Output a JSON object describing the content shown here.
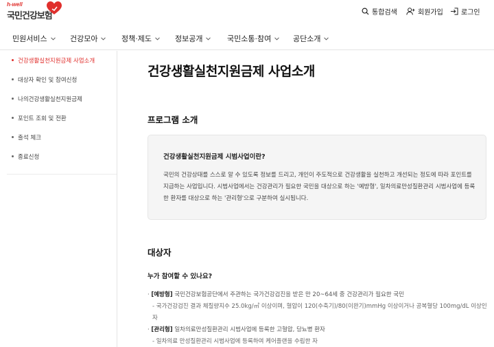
{
  "header": {
    "logo_hwell": "h-well",
    "logo_text": "국민건강보험",
    "utils": [
      {
        "label": "통합검색",
        "icon": "search-icon"
      },
      {
        "label": "회원가입",
        "icon": "user-plus-icon"
      },
      {
        "label": "로그인",
        "icon": "login-icon"
      }
    ]
  },
  "gnb": {
    "items": [
      {
        "label": "민원서비스"
      },
      {
        "label": "건강모아"
      },
      {
        "label": "정책·제도"
      },
      {
        "label": "정보공개"
      },
      {
        "label": "국민소통·참여"
      },
      {
        "label": "공단소개"
      }
    ]
  },
  "lnb": {
    "items": [
      {
        "label": "건강생활실천지원금제 사업소개",
        "active": true
      },
      {
        "label": "대상자 확인 및 참여신청"
      },
      {
        "label": "나의건강생활실천지원금제"
      },
      {
        "label": "포인트 조회 및 전환"
      },
      {
        "label": "출석 체크"
      },
      {
        "label": "종료신청"
      }
    ]
  },
  "main": {
    "title": "건강생활실천지원금제 사업소개",
    "program_section_title": "프로그램 소개",
    "infobox": {
      "title": "건강생활실천지원금제 시범사업이란?",
      "body": "국민의 건강상태를 스스로 알 수 있도록 정보를 드리고, 개인이 주도적으로 건강생활을 실천하고 개선되는 정도에 따라 포인트를 지급하는 사업입니다. 시범사업에서는 건강관리가 필요한 국민을 대상으로 하는 '예방형', 일차의료만성질환관리 시범사업에 등록한 환자를 대상으로 하는 '관리형'으로 구분하여 실시됩니다."
    },
    "target_section_title": "대상자",
    "target_question": "누가 참여할 수 있나요?",
    "bullets": [
      {
        "tag": "[예방형]",
        "text": " 국민건강보험공단에서 주관하는 국가건강검진을 받은 만 20~64세 중 건강관리가 필요한 국민",
        "sub": "- 국가건강검진 결과 체질량지수 25.0kg/㎡ 이상이며, 혈압이 120(수축기)/80(이완기)mmHg 이상이거나 공복혈당 100mg/dL 이상인 자"
      },
      {
        "tag": "[관리형]",
        "text": " 일차의료만성질환관리 시범사업에 등록한 고혈압, 당뇨병 환자",
        "sub": "- 일차의료 만성질환관리 시범사업에 등록하여 케어플랜을 수립한 자"
      }
    ]
  },
  "colors": {
    "accent": "#e0302d",
    "border": "#e3e3e3",
    "box_bg": "#f5f5f5"
  }
}
